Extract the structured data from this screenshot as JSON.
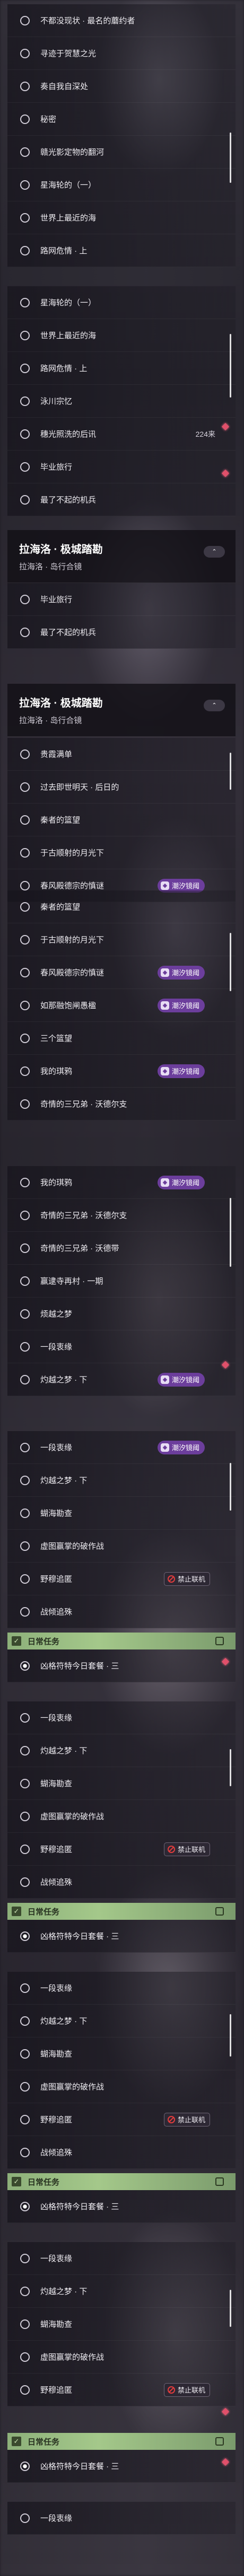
{
  "labels": {
    "collapse": "收起",
    "event_pill": "潮汐镜阈",
    "no_coop": "禁止联机",
    "ep_reward": "224来"
  },
  "seg1": [
    "不都没现状 · 最名的蘑约者",
    "寻迹于贺慧之光",
    "奏自我自深处",
    "秘密",
    "赣光影定物的翻河",
    "星海轮的（一）",
    "世界上最近的海",
    "路网危情 · 上"
  ],
  "seg2": [
    "星海轮的（一）",
    "世界上最近的海",
    "路网危情 · 上",
    "泳川宗忆",
    "穗光照洗的后讯",
    "毕业旅行",
    "最了不起的机兵"
  ],
  "seg3_header": {
    "title": "拉海洛 · 极城踏勘",
    "subtitle": "拉海洛 · 岛行合镜"
  },
  "seg3": [
    "毕业旅行",
    "最了不起的机兵"
  ],
  "seg4_header": {
    "title": "拉海洛 · 极城踏勘",
    "subtitle": "拉海洛 · 岛行合镜"
  },
  "seg4": [
    "贵霞满单",
    "过去即世明天 · 后日的",
    "秦者的篮望",
    "于古顺射的月光下",
    "春风殿德宗的慎谜"
  ],
  "seg5": [
    "秦者的篮望",
    "于古顺射的月光下",
    "春风殿德宗的慎谜",
    "如那融饱闸愚楹",
    "三个篮望",
    "我的琪鸦",
    "奇情的三兄弟 · 沃德尔支"
  ],
  "seg6": [
    "我的琪鸦",
    "奇情的三兄弟 · 沃德尔支",
    "奇情的三兄弟 · 沃德带",
    "赢逮寺再村 · 一期",
    "烦越之梦",
    "一段衷缘",
    "灼越之梦 · 下"
  ],
  "seg7": [
    "一段衷缘",
    "灼越之梦 · 下",
    "蝴海勘查",
    "虚图赢掌的破作战",
    "野穆追匿",
    "战倾追殊"
  ],
  "daily_label": "日常任务",
  "daily_task": "凶格符特今日套餐 · 三",
  "seg8": [
    "一段衷缘",
    "灼越之梦 · 下",
    "蝴海勘查",
    "虚图赢掌的破作战",
    "野穆追匿",
    "战倾追殊"
  ],
  "seg9": [
    "一段衷缘",
    "灼越之梦 · 下",
    "蝴海勘查",
    "虚图赢掌的破作战",
    "野穆追匿",
    "战倾追殊"
  ],
  "seg10": [
    "一段衷缘",
    "灼越之梦 · 下",
    "蝴海勘查",
    "虚图赢掌的破作战",
    "野穆追匿"
  ]
}
